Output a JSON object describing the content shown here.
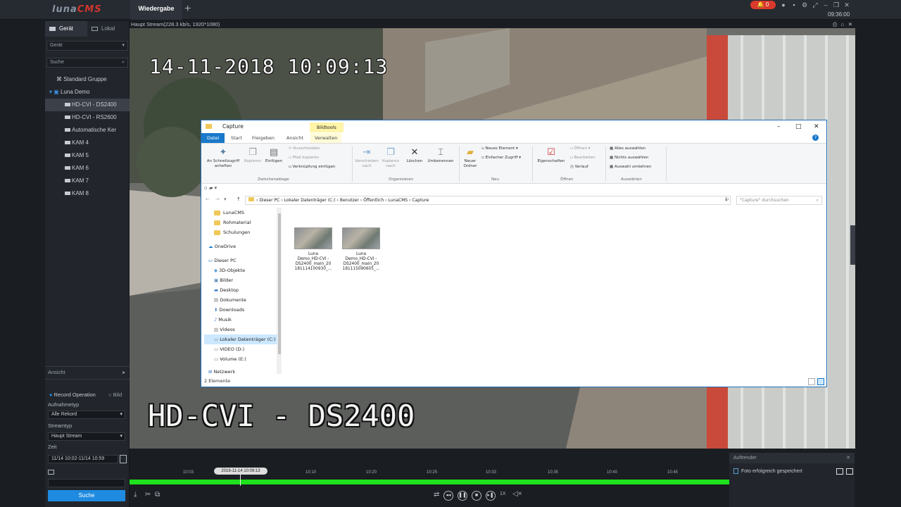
{
  "app": {
    "logo_left": "luna",
    "logo_right": "CMS",
    "tab_playback": "Wiedergabe",
    "alarm_count": "0",
    "clock": "09:36:00"
  },
  "sidebar": {
    "tab_device": "Gerät",
    "tab_local": "Lokal",
    "device_select": "Gerät",
    "search_placeholder": "Suche",
    "tree": [
      {
        "label": "Standard Gruppe"
      },
      {
        "label": "Luna Demo"
      },
      {
        "label": "HD-CVI - DS2400"
      },
      {
        "label": "HD-CVI - RS2600"
      },
      {
        "label": "Automatische Ker"
      },
      {
        "label": "KAM 4"
      },
      {
        "label": "KAM 5"
      },
      {
        "label": "KAM 6"
      },
      {
        "label": "KAM 7"
      },
      {
        "label": "KAM 8"
      }
    ],
    "view_label": "Ansicht",
    "record_operation": "Record Operation",
    "picture": "Bild",
    "record_type_label": "Aufnahmetyp",
    "record_type_value": "Alle Rekord",
    "stream_type_label": "Streamtyp",
    "stream_type_value": "Haupt Stream",
    "time_label": "Zeit",
    "time_value": "11/14 10:02-11/14 10:59",
    "search_button": "Suche"
  },
  "video": {
    "stream_info": "Haupt Stream(228.3 kb/s, 1920*1080)",
    "osd_time": "14-11-2018 10:09:13",
    "osd_camera": "HD-CVI - DS2400"
  },
  "explorer": {
    "title": "Capture",
    "tools_tab": "Bildtools",
    "ribbon_tabs": [
      "Datei",
      "Start",
      "Freigeben",
      "Ansicht",
      "Verwalten"
    ],
    "ribbon": {
      "pin": "An Schnellzugriff anheften",
      "copy": "Kopieren",
      "paste": "Einfügen",
      "cut": "Ausschneiden",
      "copy_path": "Pfad kopieren",
      "paste_shortcut": "Verknüpfung einfügen",
      "group_clipboard": "Zwischenablage",
      "move_to": "Verschieben nach",
      "copy_to": "Kopieren nach",
      "delete": "Löschen",
      "rename": "Umbenennen",
      "group_organize": "Organisieren",
      "new_folder": "Neuer Ordner",
      "new_item": "Neues Element",
      "easy_access": "Einfacher Zugriff",
      "group_new": "Neu",
      "properties": "Eigenschaften",
      "open": "Öffnen",
      "edit": "Bearbeiten",
      "history": "Verlauf",
      "group_open": "Öffnen",
      "select_all": "Alles auswählen",
      "select_none": "Nichts auswählen",
      "invert_selection": "Auswahl umkehren",
      "group_select": "Auswählen"
    },
    "breadcrumb": [
      "Dieser PC",
      "Lokaler Datenträger (C:)",
      "Benutzer",
      "Öffentlich",
      "LunaCMS",
      "Capture"
    ],
    "search_placeholder": "\"Capture\" durchsuchen",
    "nav": [
      {
        "label": "LunaCMS"
      },
      {
        "label": "Rohmaterial"
      },
      {
        "label": "Schulungen"
      },
      {
        "label": "OneDrive"
      },
      {
        "label": "Dieser PC"
      },
      {
        "label": "3D-Objekte"
      },
      {
        "label": "Bilder"
      },
      {
        "label": "Desktop"
      },
      {
        "label": "Dokumente"
      },
      {
        "label": "Downloads"
      },
      {
        "label": "Musik"
      },
      {
        "label": "Videos"
      },
      {
        "label": "Lokaler Datenträger (C:)"
      },
      {
        "label": "VIDEO (D:)"
      },
      {
        "label": "Volume (E:)"
      },
      {
        "label": "Netzwerk"
      }
    ],
    "files": [
      {
        "line1": "Luna",
        "line2": "Demo_HD-CVI -",
        "line3": "DS2400_main_20",
        "line4": "181114100930_..."
      },
      {
        "line1": "Luna",
        "line2": "Demo_HD-CVI -",
        "line3": "DS2400_main_20",
        "line4": "181115090605_..."
      }
    ],
    "status": "2 Elemente"
  },
  "timeline": {
    "cursor_label": "2018-11-14 10:09:13",
    "ticks": [
      "10:03",
      "10:10",
      "10:20",
      "10:25",
      "10:33",
      "10:35",
      "10:40",
      "10:45"
    ],
    "speed": "1X"
  },
  "notification": {
    "title": "Auftrender",
    "message": "Foto erfolgreich gespeichert"
  }
}
